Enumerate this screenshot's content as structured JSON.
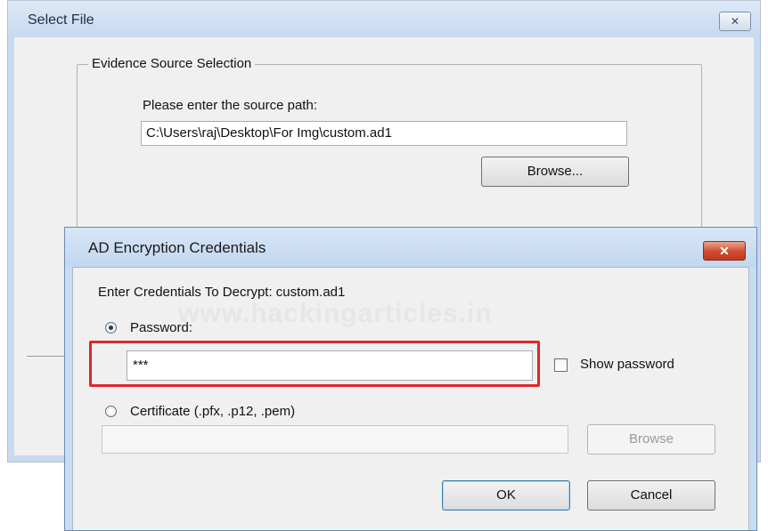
{
  "select_file": {
    "title": "Select File",
    "close_glyph": "✕",
    "group_label": "Evidence Source Selection",
    "source_label": "Please enter the source path:",
    "source_value": "C:\\Users\\raj\\Desktop\\For Img\\custom.ad1",
    "browse_label": "Browse..."
  },
  "credentials_dialog": {
    "title": "AD Encryption Credentials",
    "close_glyph": "✕",
    "prompt": "Enter Credentials To Decrypt: custom.ad1",
    "watermark": "www.hackingarticles.in",
    "password_option": {
      "label": "Password:",
      "selected": true
    },
    "password_value": "***",
    "show_password": {
      "label": "Show password",
      "checked": false
    },
    "certificate_option": {
      "label": "Certificate (.pfx, .p12, .pem)",
      "selected": false
    },
    "certificate_value": "",
    "certificate_browse_label": "Browse",
    "ok_label": "OK",
    "cancel_label": "Cancel",
    "highlight_color": "#e0262b"
  }
}
